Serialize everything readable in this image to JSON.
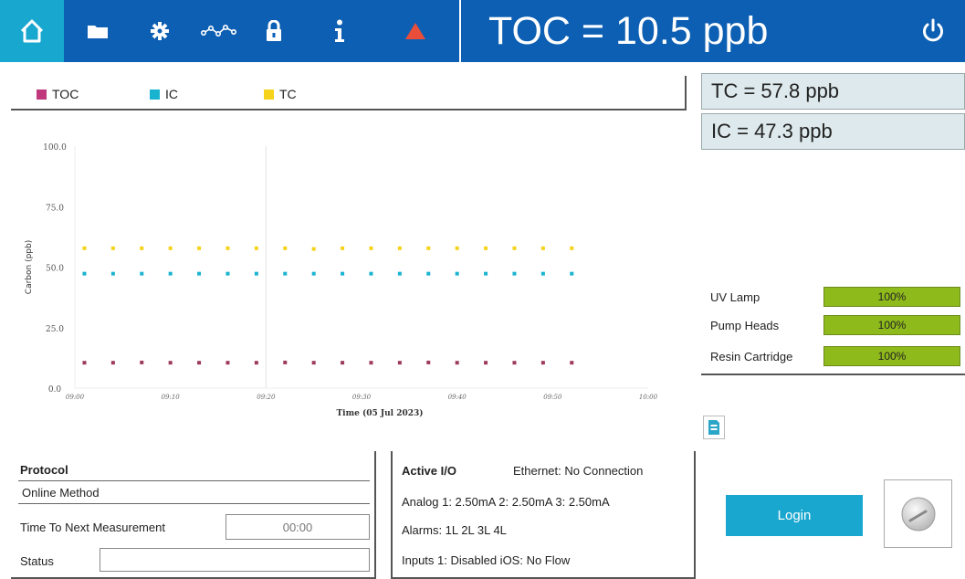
{
  "header": {
    "toc_display": "TOC = 10.5 ppb",
    "icons": [
      "home-icon",
      "folder-icon",
      "gear-icon",
      "trend-icon",
      "lock-icon",
      "info-icon",
      "alarm-triangle-icon",
      "power-icon"
    ],
    "colors": {
      "bar": "#0d5fb3",
      "home_active": "#18a7cf",
      "alarm": "#e94e3a"
    }
  },
  "legend": [
    {
      "label": "TOC",
      "color": "#c0397d"
    },
    {
      "label": "IC",
      "color": "#1ab3cf"
    },
    {
      "label": "TC",
      "color": "#f5d31a"
    }
  ],
  "readings": {
    "tc": "TC = 57.8 ppb",
    "ic": "IC = 47.3 ppb"
  },
  "consumables": [
    {
      "label": "UV Lamp",
      "percent_text": "100%",
      "level": 1.0
    },
    {
      "label": "Pump Heads",
      "percent_text": "100%",
      "level": 1.0
    },
    {
      "label": "Resin Cartridge",
      "percent_text": "100%",
      "level": 1.0
    }
  ],
  "chart_data": {
    "type": "scatter",
    "xlabel": "Time (05 Jul 2023)",
    "ylabel": "Carbon (ppb)",
    "ylim": [
      0,
      100
    ],
    "yticks": [
      "0.0",
      "25.0",
      "50.0",
      "75.0",
      "100.0"
    ],
    "xticks": [
      "09:00",
      "09:10",
      "09:20",
      "09:30",
      "09:40",
      "09:50",
      "10:00"
    ],
    "xlim_minutes": [
      0,
      60
    ],
    "x_minutes": [
      0,
      3,
      6,
      9,
      12,
      15,
      18,
      21,
      24,
      27,
      30,
      33,
      36,
      39,
      42,
      45,
      48,
      51
    ],
    "series": [
      {
        "name": "TOC",
        "color": "#9e3a5a",
        "values": [
          10.5,
          10.5,
          10.6,
          10.5,
          10.5,
          10.5,
          10.5,
          10.6,
          10.5,
          10.5,
          10.5,
          10.5,
          10.6,
          10.5,
          10.5,
          10.5,
          10.5,
          10.5
        ]
      },
      {
        "name": "IC",
        "color": "#1ab3cf",
        "values": [
          47.3,
          47.3,
          47.3,
          47.3,
          47.3,
          47.3,
          47.3,
          47.3,
          47.3,
          47.3,
          47.3,
          47.3,
          47.3,
          47.3,
          47.3,
          47.3,
          47.3,
          47.3
        ]
      },
      {
        "name": "TC",
        "color": "#f5d31a",
        "values": [
          57.8,
          57.8,
          57.8,
          57.8,
          57.8,
          57.8,
          57.8,
          57.8,
          57.5,
          57.8,
          57.8,
          57.8,
          57.8,
          57.8,
          57.8,
          57.8,
          57.8,
          57.8
        ]
      }
    ]
  },
  "protocol": {
    "title": "Protocol",
    "method": "Online Method",
    "next_label": "Time To Next Measurement",
    "next_value": "00:00",
    "status_label": "Status",
    "status_value": ""
  },
  "io": {
    "title": "Active I/O",
    "ethernet": "Ethernet: No Connection",
    "analog": "Analog 1: 2.50mA  2: 2.50mA  3: 2.50mA",
    "alarms": "Alarms: 1L 2L 3L 4L",
    "inputs": "Inputs 1: Disabled  iOS: No Flow"
  },
  "login": {
    "label": "Login"
  }
}
